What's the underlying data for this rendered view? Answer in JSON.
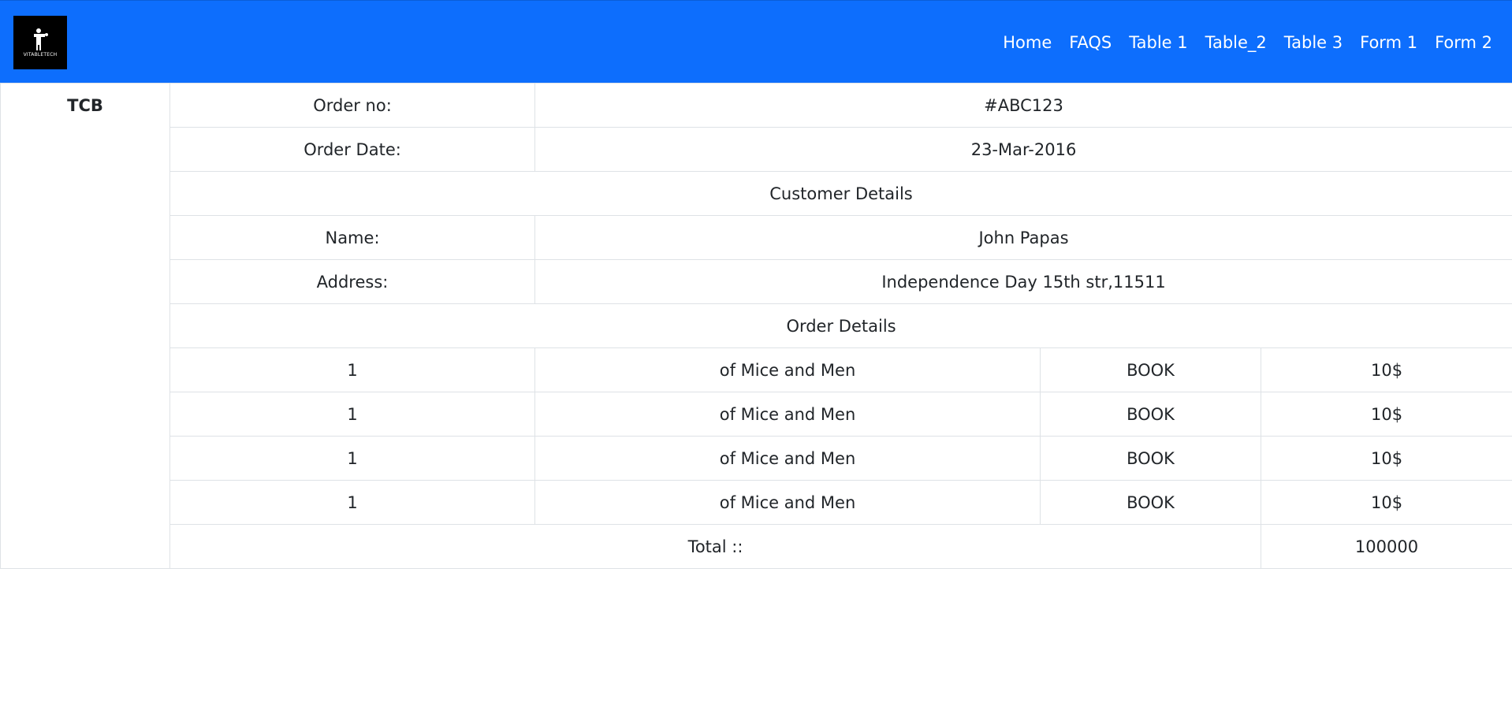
{
  "navbar": {
    "logo": {
      "text": "VITABLETECH",
      "icon": "logo-mark-icon"
    },
    "links": [
      "Home",
      "FAQS",
      "Table 1",
      "Table_2",
      "Table 3",
      "Form 1",
      "Form 2"
    ],
    "background_color": "#0d6efd"
  },
  "invoice": {
    "brand": "TCB",
    "order_no_label": "Order no:",
    "order_no_value": "#ABC123",
    "order_date_label": "Order Date:",
    "order_date_value": "23-Mar-2016",
    "customer_details_heading": "Customer Details",
    "name_label": "Name:",
    "name_value": "John Papas",
    "address_label": "Address:",
    "address_value": "Independence Day 15th str,11511",
    "order_details_heading": "Order Details",
    "items": [
      {
        "qty": "1",
        "title": "of Mice and Men",
        "type": "BOOK",
        "price": "10$"
      },
      {
        "qty": "1",
        "title": "of Mice and Men",
        "type": "BOOK",
        "price": "10$"
      },
      {
        "qty": "1",
        "title": "of Mice and Men",
        "type": "BOOK",
        "price": "10$"
      },
      {
        "qty": "1",
        "title": "of Mice and Men",
        "type": "BOOK",
        "price": "10$"
      }
    ],
    "total_label": "Total ::",
    "total_value": "100000",
    "border_color": "#dee2e6"
  }
}
